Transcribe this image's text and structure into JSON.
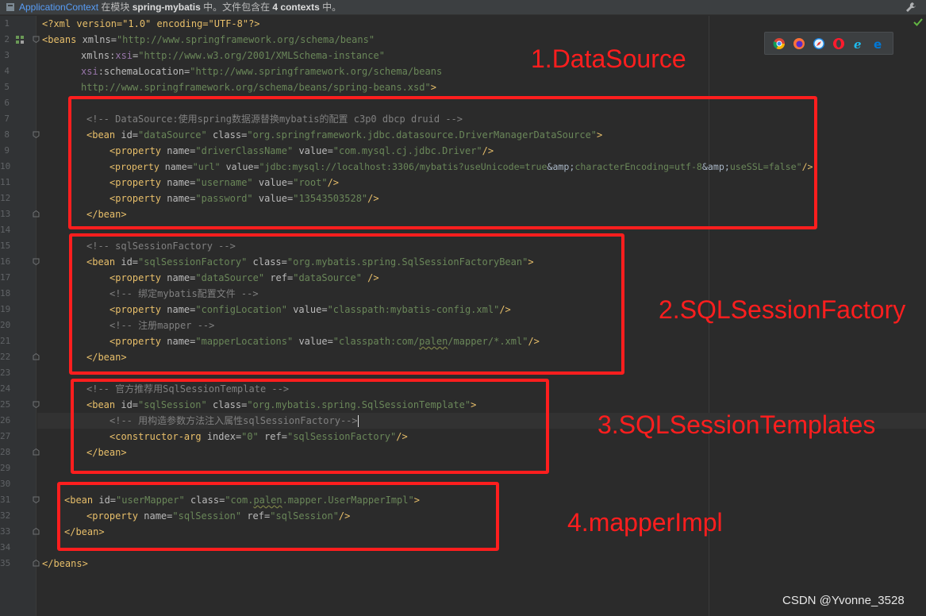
{
  "status_bar": {
    "context_link": "ApplicationContext",
    "text_1": " 在模块 ",
    "module": "spring-mybatis",
    "text_2": " 中。文件包含在 ",
    "contexts": "4 contexts",
    "text_3": " 中。"
  },
  "editor": {
    "line_numbers": [
      "1",
      "2",
      "3",
      "4",
      "5",
      "6",
      "7",
      "8",
      "9",
      "10",
      "11",
      "12",
      "13",
      "14",
      "15",
      "16",
      "17",
      "18",
      "19",
      "20",
      "21",
      "22",
      "23",
      "24",
      "25",
      "26",
      "27",
      "28",
      "29",
      "30",
      "31",
      "32",
      "33",
      "34",
      "35"
    ],
    "line1": {
      "text": "<?xml version=\"1.0\" encoding=\"UTF-8\"?>"
    },
    "line2": {
      "open": "<beans",
      "attr": " xmlns=",
      "val": "\"http://www.springframework.org/schema/beans\""
    },
    "line3": {
      "attr": "xmlns:",
      "ns": "xsi",
      "eq": "=",
      "val": "\"http://www.w3.org/2001/XMLSchema-instance\""
    },
    "line4": {
      "ns": "xsi",
      "attr": ":schemaLocation=",
      "val": "\"http://www.springframework.org/schema/beans"
    },
    "line5": {
      "val": "http://www.springframework.org/schema/beans/spring-beans.xsd\"",
      "close": ">"
    },
    "line7": {
      "comment": "<!-- DataSource:使用spring数据源替换mybatis的配置 c3p0 dbcp druid -->"
    },
    "line8": {
      "open": "<bean",
      "a1": " id=",
      "v1": "\"dataSource\"",
      "a2": " class=",
      "v2": "\"org.springframework.jdbc.datasource.DriverManagerDataSource\"",
      "close": ">"
    },
    "line9": {
      "open": "<property",
      "a1": " name=",
      "v1": "\"driverClassName\"",
      "a2": " value=",
      "v2": "\"com.mysql.cj.jdbc.Driver\"",
      "close": "/>"
    },
    "line10": {
      "open": "<property",
      "a1": " name=",
      "v1": "\"url\"",
      "a2": " value=",
      "v2a": "\"jdbc:mysql://localhost:3306/mybatis?useUnicode=true",
      "e1": "&amp;",
      "v2b": "characterEncoding=utf-8",
      "e2": "&amp;",
      "v2c": "useSSL=false\"",
      "close": "/>"
    },
    "line11": {
      "open": "<property",
      "a1": " name=",
      "v1": "\"username\"",
      "a2": " value=",
      "v2": "\"root\"",
      "close": "/>"
    },
    "line12": {
      "open": "<property",
      "a1": " name=",
      "v1": "\"password\"",
      "a2": " value=",
      "v2": "\"13543503528\"",
      "close": "/>"
    },
    "line13": {
      "text": "</bean>"
    },
    "line15": {
      "comment": "<!-- sqlSessionFactory -->"
    },
    "line16": {
      "open": "<bean",
      "a1": " id=",
      "v1": "\"sqlSessionFactory\"",
      "a2": " class=",
      "v2": "\"org.mybatis.spring.SqlSessionFactoryBean\"",
      "close": ">"
    },
    "line17": {
      "open": "<property",
      "a1": " name=",
      "v1": "\"dataSource\"",
      "a2": " ref=",
      "v2": "\"dataSource\"",
      "close": " />"
    },
    "line18": {
      "comment": "<!-- 绑定mybatis配置文件 -->"
    },
    "line19": {
      "open": "<property",
      "a1": " name=",
      "v1": "\"configLocation\"",
      "a2": " value=",
      "v2": "\"classpath:mybatis-config.xml\"",
      "close": "/>"
    },
    "line20": {
      "comment": "<!-- 注册mapper -->"
    },
    "line21": {
      "open": "<property",
      "a1": " name=",
      "v1": "\"mapperLocations\"",
      "a2": " value=",
      "v2a": "\"classpath:com/",
      "v2u": "palen",
      "v2b": "/mapper/*.xml\"",
      "close": "/>"
    },
    "line22": {
      "text": "</bean>"
    },
    "line24": {
      "comment": "<!-- 官方推荐用SqlSessionTemplate -->"
    },
    "line25": {
      "open": "<bean",
      "a1": " id=",
      "v1": "\"sqlSession\"",
      "a2": " class=",
      "v2": "\"org.mybatis.spring.SqlSessionTemplate\"",
      "close": ">"
    },
    "line26": {
      "comment": "<!-- 用构造参数方法注入属性sqlSessionFactory-->"
    },
    "line27": {
      "open": "<constructor-arg",
      "a1": " index=",
      "v1": "\"0\"",
      "a2": " ref=",
      "v2": "\"sqlSessionFactory\"",
      "close": "/>"
    },
    "line28": {
      "text": "</bean>"
    },
    "line31": {
      "open": "<bean",
      "a1": " id=",
      "v1": "\"userMapper\"",
      "a2": " class=",
      "v2a": "\"com.",
      "v2u": "palen",
      "v2b": ".mapper.UserMapperImpl\"",
      "close": ">"
    },
    "line32": {
      "open": "<property",
      "a1": " name=",
      "v1": "\"sqlSession\"",
      "a2": " ref=",
      "v2": "\"sqlSession\"",
      "close": "/>"
    },
    "line33": {
      "text": "</bean>"
    },
    "line35": {
      "text": "</beans>"
    }
  },
  "annotations": {
    "label1": "1.DataSource",
    "label2": "2.SQLSessionFactory",
    "label3": "3.SQLSessionTemplates",
    "label4": "4.mapperImpl"
  },
  "watermark": "CSDN @Yvonne_3528",
  "colors": {
    "annotation_red": "#ff1e1e",
    "tag": "#e8bf6a",
    "attribute_value": "#6a8759",
    "comment": "#808080",
    "editor_bg": "#2b2b2b"
  },
  "icons": [
    "application-context-icon",
    "wrench-icon",
    "chrome-icon",
    "firefox-icon",
    "safari-icon",
    "opera-icon",
    "ie-icon",
    "edge-icon",
    "spring-bean-icon",
    "fold-icon",
    "check-icon"
  ]
}
